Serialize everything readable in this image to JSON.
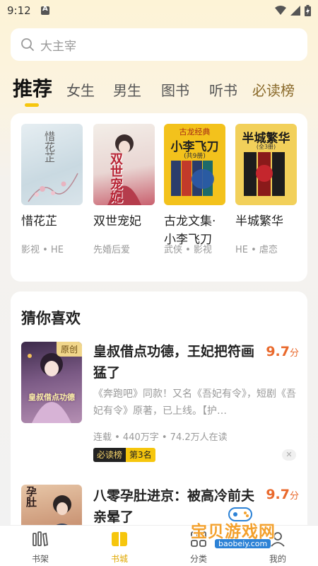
{
  "status_bar": {
    "time": "9:12"
  },
  "search": {
    "placeholder": "大主宰"
  },
  "tabs": [
    {
      "label": "推荐",
      "active": true
    },
    {
      "label": "女生"
    },
    {
      "label": "男生"
    },
    {
      "label": "图书"
    },
    {
      "label": "听书"
    },
    {
      "label": "必读榜"
    }
  ],
  "recommended": [
    {
      "title": "惜花芷",
      "tags": "影视 • HE",
      "cover_text": "惜花芷"
    },
    {
      "title": "双世宠妃",
      "tags": "先婚后爱",
      "cover_text": "双世宠妃"
    },
    {
      "title": "古龙文集·小李飞刀",
      "tags": "武侠 • 影视",
      "cover_text": "小李飞刀",
      "cover_top": "古龙经典",
      "cover_sub": "(共9册)"
    },
    {
      "title": "半城繁华",
      "tags": "HE • 虐恋",
      "cover_text": "半城繁华",
      "cover_sub": "(全3册)"
    }
  ],
  "guess": {
    "title": "猜你喜欢",
    "items": [
      {
        "badge": "原创",
        "title": "皇叔借点功德，王妃把符画猛了",
        "score": "9.7",
        "score_unit": "分",
        "desc": "《奔跑吧》同款！又名《吾妃有令》，短剧《吾妃有令》原著，已上线。【护…",
        "meta": "连载 • 440万字 • 74.2万人在读",
        "rank_label": "必读榜",
        "rank_value": "第3名",
        "cover_text": "皇叔借点功德"
      },
      {
        "title": "八零孕肚进京：被高冷前夫亲晕了",
        "score": "9.7",
        "score_unit": "分",
        "cover_text": "孕肚"
      }
    ]
  },
  "bottom_nav": [
    {
      "label": "书架",
      "icon": "bookshelf-icon"
    },
    {
      "label": "书城",
      "icon": "bookstore-icon",
      "active": true
    },
    {
      "label": "分类",
      "icon": "category-icon"
    },
    {
      "label": "我的",
      "icon": "profile-icon"
    }
  ],
  "watermark": {
    "text": "宝贝游戏网",
    "url": "baobeiy.com"
  },
  "colors": {
    "accent": "#f6c60d",
    "score": "#e9692c"
  }
}
